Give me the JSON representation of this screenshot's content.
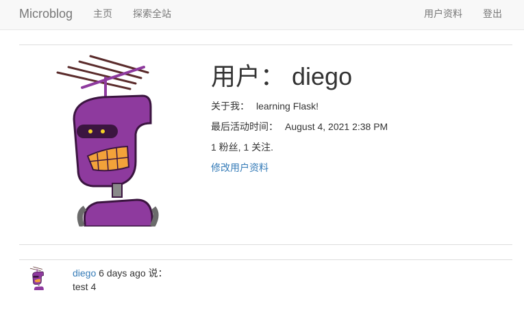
{
  "nav": {
    "brand": "Microblog",
    "home": "主页",
    "explore": "探索全站",
    "profile": "用户资料",
    "logout": "登出"
  },
  "profile": {
    "title": "用户： diego",
    "about_label": "关于我：",
    "about_value": "learning Flask!",
    "last_seen_label": "最后活动时间：",
    "last_seen_value": "August 4, 2021 2:38 PM",
    "followers_text": "1 粉丝, 1 关注.",
    "edit_link": "修改用户资料",
    "avatar_icon": "robot-avatar-icon"
  },
  "posts": [
    {
      "author": "diego",
      "meta": " 6 days ago 说：",
      "body": "test 4",
      "avatar_icon": "robot-avatar-icon"
    }
  ],
  "colors": {
    "link": "#337ab7",
    "navbar_bg": "#f8f8f8",
    "nav_text": "#777777",
    "text": "#333333",
    "robot_purple": "#8e3a9e"
  }
}
